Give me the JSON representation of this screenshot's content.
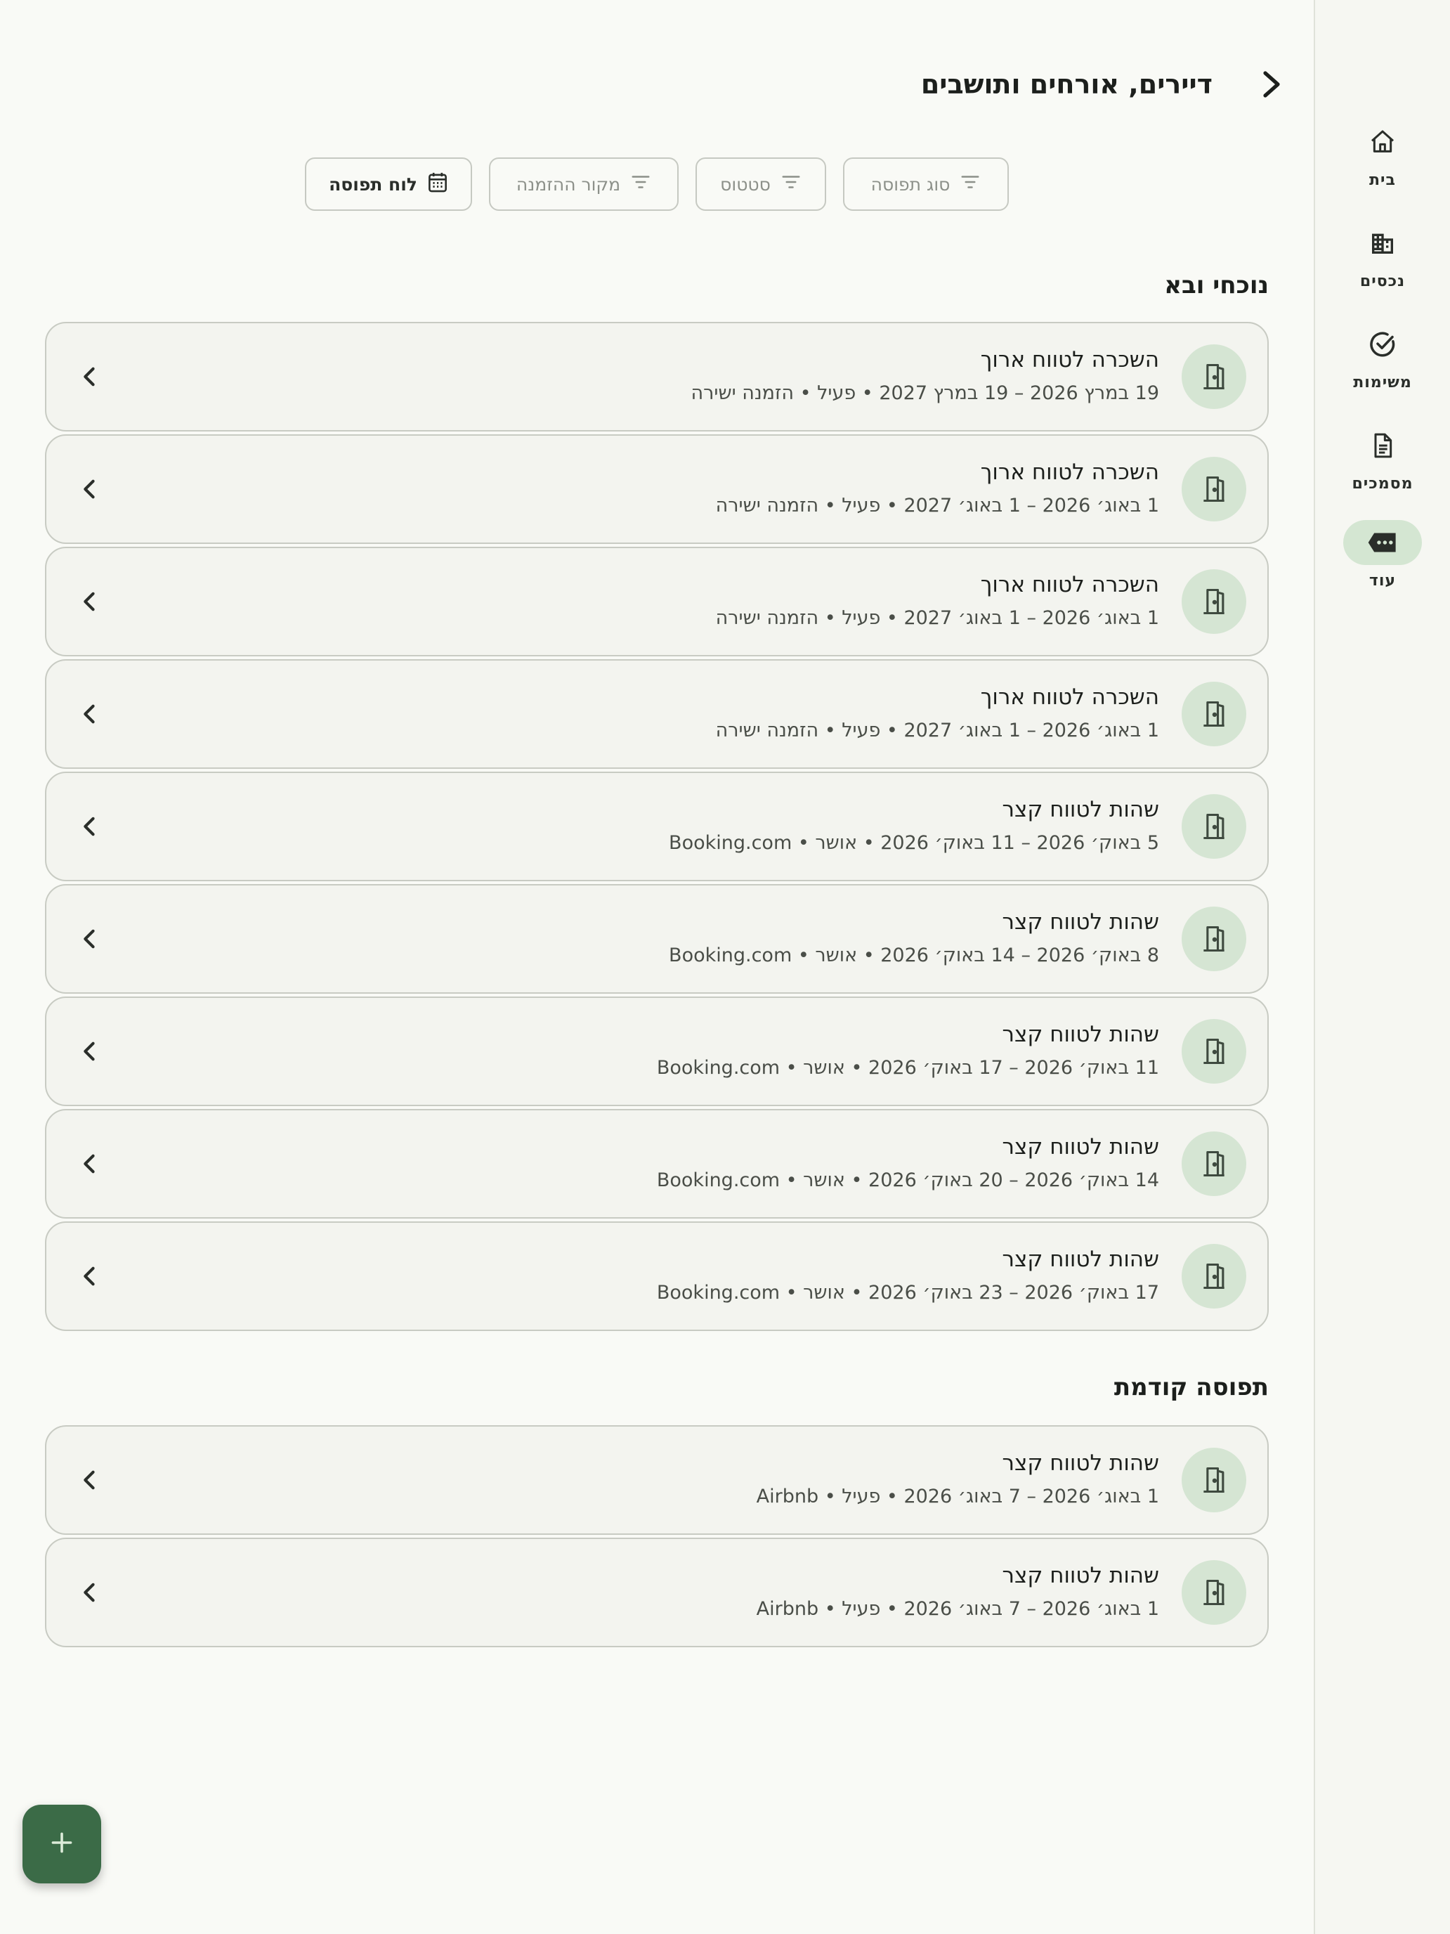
{
  "header": {
    "title": "דיירים, אורחים ותושבים"
  },
  "nav": {
    "items": [
      {
        "label": "בית",
        "icon": "home-icon"
      },
      {
        "label": "נכסים",
        "icon": "building-icon"
      },
      {
        "label": "משימות",
        "icon": "check-circle-icon"
      },
      {
        "label": "מסמכים",
        "icon": "document-icon"
      },
      {
        "label": "עוד",
        "icon": "more-icon",
        "active": true
      }
    ]
  },
  "filters": {
    "occupancy_type": "סוג תפוסה",
    "status": "סטטוס",
    "booking_source": "מקור ההזמנה",
    "calendar": "לוח תפוסה"
  },
  "sections": {
    "current": {
      "title": "נוכחי ובא",
      "items": [
        {
          "title": "השכרה לטווח ארוך",
          "subtitle": "19 במרץ 2026 – 19 במרץ 2027 • פעיל • הזמנה ישירה"
        },
        {
          "title": "השכרה לטווח ארוך",
          "subtitle": "1 באוג׳ 2026 – 1 באוג׳ 2027 • פעיל • הזמנה ישירה"
        },
        {
          "title": "השכרה לטווח ארוך",
          "subtitle": "1 באוג׳ 2026 – 1 באוג׳ 2027 • פעיל • הזמנה ישירה"
        },
        {
          "title": "השכרה לטווח ארוך",
          "subtitle": "1 באוג׳ 2026 – 1 באוג׳ 2027 • פעיל • הזמנה ישירה"
        },
        {
          "title": "שהות לטווח קצר",
          "subtitle": "5 באוק׳ 2026 – 11 באוק׳ 2026 • אושר • Booking.com"
        },
        {
          "title": "שהות לטווח קצר",
          "subtitle": "8 באוק׳ 2026 – 14 באוק׳ 2026 • אושר • Booking.com"
        },
        {
          "title": "שהות לטווח קצר",
          "subtitle": "11 באוק׳ 2026 – 17 באוק׳ 2026 • אושר • Booking.com"
        },
        {
          "title": "שהות לטווח קצר",
          "subtitle": "14 באוק׳ 2026 – 20 באוק׳ 2026 • אושר • Booking.com"
        },
        {
          "title": "שהות לטווח קצר",
          "subtitle": "17 באוק׳ 2026 – 23 באוק׳ 2026 • אושר • Booking.com"
        }
      ]
    },
    "previous": {
      "title": "תפוסה קודמת",
      "items": [
        {
          "title": "שהות לטווח קצר",
          "subtitle": "1 באוג׳ 2026 – 7 באוג׳ 2026 • פעיל • Airbnb"
        },
        {
          "title": "שהות לטווח קצר",
          "subtitle": "1 באוג׳ 2026 – 7 באוג׳ 2026 • פעיל • Airbnb"
        }
      ]
    }
  },
  "colors": {
    "accent": "#3b6b47",
    "icon_circle": "#d5e5d3",
    "background": "#f9faf6"
  }
}
